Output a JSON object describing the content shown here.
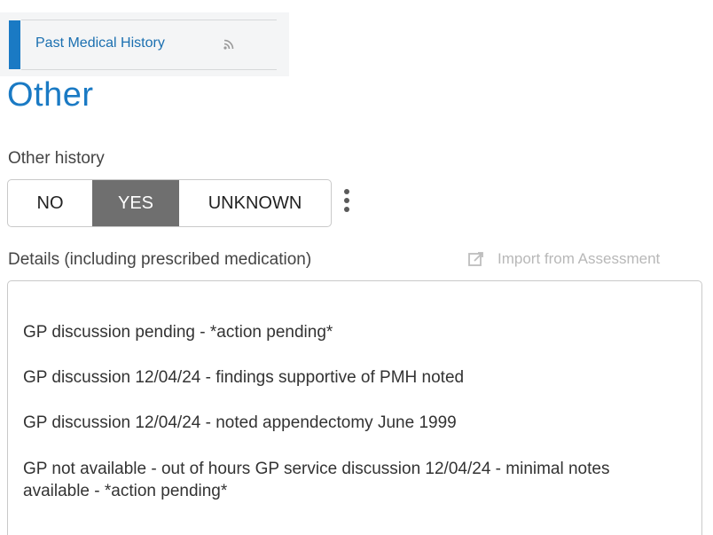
{
  "nav": {
    "item_label": "Past Medical History",
    "item_icon": "rss-feed-icon",
    "accent_color": "#1a7ac4"
  },
  "section": {
    "title": "Other"
  },
  "other_history": {
    "label": "Other history",
    "options": [
      "NO",
      "YES",
      "UNKNOWN"
    ],
    "selected": "YES",
    "more_icon": "kebab-menu-icon"
  },
  "details": {
    "label": "Details (including prescribed medication)",
    "import_label": "Import from Assessment",
    "import_icon": "import-edit-icon",
    "entries": [
      "GP discussion pending -  *action pending*",
      "GP discussion 12/04/24 - findings supportive of PMH noted",
      "GP discussion 12/04/24  - noted appendectomy June 1999",
      "GP not available - out of hours GP service discussion 12/04/24 - minimal notes available - *action pending*"
    ]
  }
}
